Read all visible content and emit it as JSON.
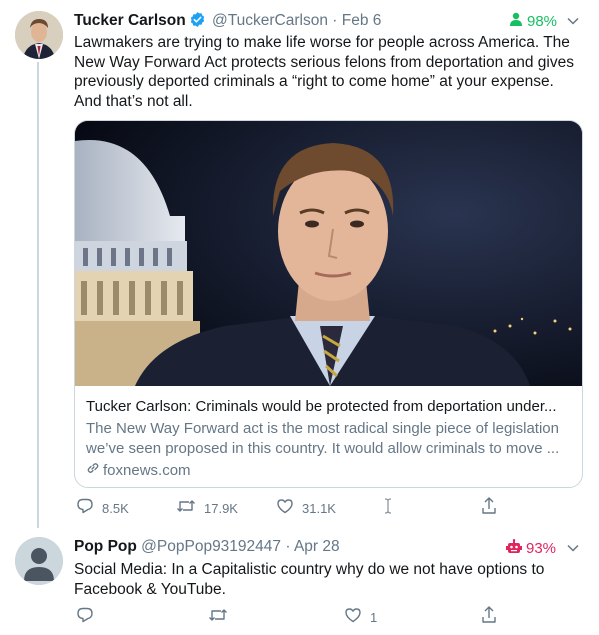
{
  "tweet1": {
    "name": "Tucker Carlson",
    "handle": "@TuckerCarlson",
    "separator": "·",
    "date": "Feb 6",
    "score": "98%",
    "text_lines": [
      "Lawmakers are trying to make life worse for people across America.  The",
      "New Way Forward Act protects serious felons from deportation and gives",
      "previously deported criminals a “right to come home” at your expense.",
      "And that’s not all."
    ],
    "card": {
      "title": "Tucker Carlson: Criminals would be protected from deportation under...",
      "desc_lines": [
        "The New Way Forward act is the most radical single piece of legislation",
        "we’ve seen proposed in this country. It would allow criminals to move ..."
      ],
      "link": "foxnews.com"
    },
    "replies": "8.5K",
    "retweets": "17.9K",
    "likes": "31.1K"
  },
  "tweet2": {
    "name": "Pop Pop",
    "handle": "@PopPop93192447",
    "separator": "·",
    "date": "Apr 28",
    "score": "93%",
    "text_lines": [
      "Social Media:  In  a Capitalistic country why do we not have options to",
      "Facebook & YouTube."
    ],
    "likes": "1"
  },
  "colors": {
    "good": "#17bf63",
    "bad": "#e0245e",
    "verified": "#1da1f2",
    "muted": "#657786"
  }
}
